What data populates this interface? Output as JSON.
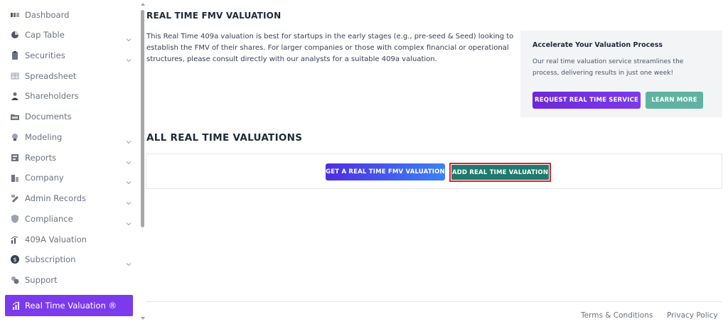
{
  "sidebar": {
    "items": [
      {
        "label": "Dashboard",
        "icon": "dashboard-icon",
        "chevron": false
      },
      {
        "label": "Cap Table",
        "icon": "pie-chart-icon",
        "chevron": true
      },
      {
        "label": "Securities",
        "icon": "clipboard-icon",
        "chevron": true
      },
      {
        "label": "Spreadsheet",
        "icon": "spreadsheet-icon",
        "chevron": false
      },
      {
        "label": "Shareholders",
        "icon": "user-icon",
        "chevron": false
      },
      {
        "label": "Documents",
        "icon": "folder-icon",
        "chevron": false
      },
      {
        "label": "Modeling",
        "icon": "lightbulb-icon",
        "chevron": true
      },
      {
        "label": "Reports",
        "icon": "report-icon",
        "chevron": true
      },
      {
        "label": "Company",
        "icon": "building-icon",
        "chevron": true
      },
      {
        "label": "Admin Records",
        "icon": "admin-records-icon",
        "chevron": true
      },
      {
        "label": "Compliance",
        "icon": "shield-icon",
        "chevron": true
      },
      {
        "label": "409A Valuation",
        "icon": "chart-icon",
        "chevron": false
      },
      {
        "label": "Subscription",
        "icon": "dollar-icon",
        "chevron": true
      },
      {
        "label": "Support",
        "icon": "support-icon",
        "chevron": false
      },
      {
        "label": "Real Time Valuation ®",
        "icon": "bar-chart-icon",
        "chevron": false,
        "active": true
      }
    ]
  },
  "main": {
    "title": "REAL TIME FMV VALUATION",
    "intro": "This Real Time 409a valuation is best for startups in the early stages (e.g., pre-seed & Seed) looking to establish the FMV of their shares. For larger companies or those with complex financial or operational structures, please consult directly with our analysts for a suitable 409a valuation.",
    "promo": {
      "title": "Accelerate Your Valuation Process",
      "text": "Our real time valuation service streamlines the process, delivering results in just one week!",
      "request_label": "REQUEST REAL TIME SERVICE",
      "learn_label": "LEARN MORE"
    },
    "section_title": "ALL REAL TIME VALUATIONS",
    "get_label": "GET A REAL TIME FMV VALUATION",
    "add_label": "ADD REAL TIME VALUATION"
  },
  "footer": {
    "terms": "Terms & Conditions",
    "privacy": "Privacy Policy"
  },
  "colors": {
    "accent": "#7c3aed",
    "teal": "#1f7a6d",
    "highlight": "#dc2626"
  }
}
